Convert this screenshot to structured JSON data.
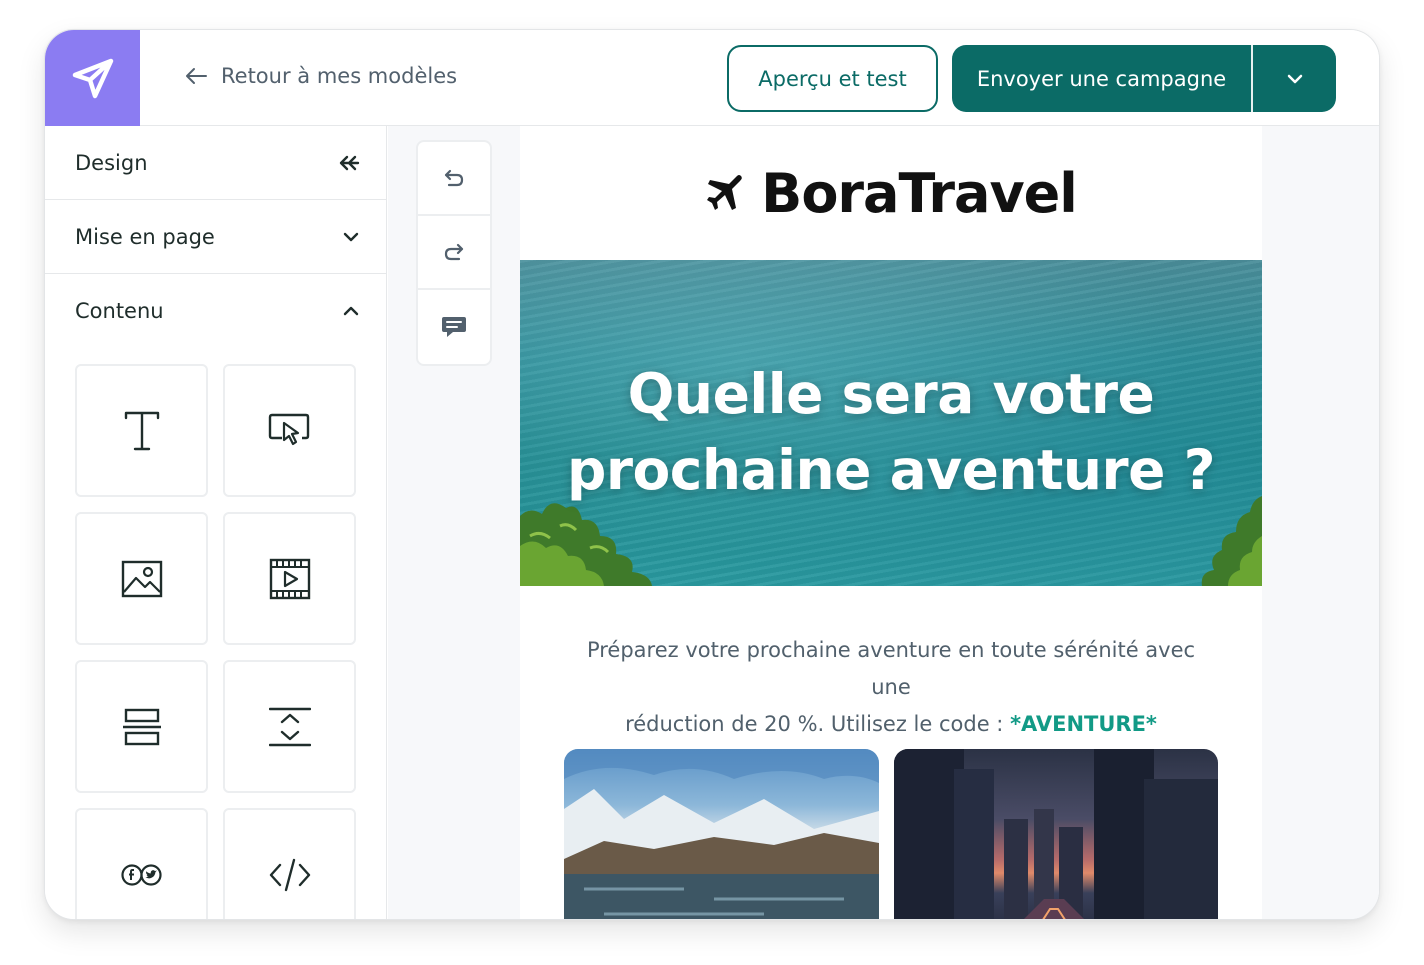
{
  "topbar": {
    "back_label": "Retour à mes modèles",
    "preview_label": "Aperçu et test",
    "send_label": "Envoyer une campagne"
  },
  "sidebar": {
    "sections": [
      {
        "label": "Design",
        "icon": "double-chevron-left-icon"
      },
      {
        "label": "Mise en page",
        "icon": "chevron-down-icon"
      },
      {
        "label": "Contenu",
        "icon": "chevron-up-icon"
      }
    ],
    "blocks": [
      {
        "icon": "text-block-icon"
      },
      {
        "icon": "button-block-icon"
      },
      {
        "icon": "image-block-icon"
      },
      {
        "icon": "video-block-icon"
      },
      {
        "icon": "divider-block-icon"
      },
      {
        "icon": "spacer-block-icon"
      },
      {
        "icon": "social-block-icon"
      },
      {
        "icon": "code-block-icon"
      }
    ]
  },
  "toolbar": {
    "tools": [
      {
        "icon": "undo-icon"
      },
      {
        "icon": "redo-icon"
      },
      {
        "icon": "comment-icon"
      }
    ]
  },
  "email": {
    "brand": "BoraTravel",
    "hero_line1": "Quelle sera votre",
    "hero_line2": "prochaine aventure ?",
    "intro_line1": "Préparez votre prochaine aventure en toute sérénité avec une",
    "intro_line2": "réduction de 20 %. Utilisez le code :",
    "promo_code": "*AVENTURE*"
  },
  "colors": {
    "brand_purple": "#8b7cf2",
    "primary_teal": "#0b6b66",
    "promo_green": "#129a86"
  }
}
